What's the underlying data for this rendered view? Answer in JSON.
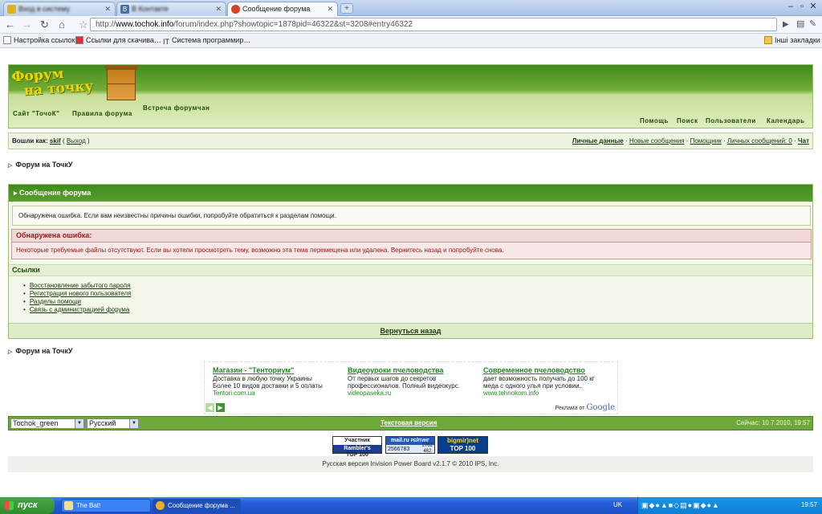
{
  "browser": {
    "tabs": [
      {
        "label": "Вход в систему",
        "active": false
      },
      {
        "label": "В Контакте",
        "active": false
      },
      {
        "label": "Сообщение форума",
        "active": true
      }
    ],
    "url_prefix": "http://",
    "url_host": "www.tochok.info",
    "url_path": "/forum/index.php?showtopic=1878pid=46322&st=3208#entry46322",
    "bookmarks": [
      "Настройка ссылок",
      "Ссылки для скачива…",
      "Система программир…"
    ],
    "other_bookmarks": "Інші закладки"
  },
  "forum": {
    "logo_line1": "Форум",
    "logo_line2": "на точку",
    "nav_left": [
      "Сайт \"ТочоК\"",
      "Правила форума"
    ],
    "nav_meeting": "Встреча форумчан",
    "nav_right": [
      "Помощь",
      "Поиск",
      "Пользователи",
      "Календарь"
    ]
  },
  "userbar": {
    "logged_in_as": "Вошли как:",
    "username": "skif",
    "logout": "Выход",
    "links": [
      "Личные данные",
      "Новые сообщения",
      "Помощник",
      "Личных сообщений: 0",
      "Чат"
    ]
  },
  "breadcrumb": "Форум на ТочкУ",
  "main": {
    "title": "Сообщение форума",
    "info": "Обнаружена ошибка. Если вам неизвестны причины ошибки, попробуйте обратиться к разделам помощи.",
    "error_title": "Обнаружена ошибка:",
    "error_text": "Некоторые требуемые файлы отсутствуют. Если вы хотели просмотреть тему, возможно эта тема перемещена или удалена. Вернитесь назад и попробуйте снова.",
    "links_title": "Ссылки",
    "links": [
      "Восстановление забытого пароля",
      "Регистрация нового пользователя",
      "Разделы помощи",
      "Связь с администрацией форума"
    ],
    "back": "Вернуться назад"
  },
  "ads": [
    {
      "title": "Магазин - \"Тенториум\"",
      "line1": "Доставка в любую точку Украины",
      "line2": "Более 10 видов доставки и 5 оплаты",
      "url": "Tentori.com.ua"
    },
    {
      "title": "Видеоуроки пчеловодства",
      "line1": "От первых шагов до секретов",
      "line2": "профессионалов. Полный видеокурс.",
      "url": "videopaseka.ru"
    },
    {
      "title": "Современное пчеловодство",
      "line1": "дает возможность получать до 100 кг",
      "line2": "меда с одного улья при условии..",
      "url": "www.tehnokom.info"
    }
  ],
  "ads_by": "Реклама от",
  "ads_brand": "Google",
  "footer": {
    "skin": "Tochok_green",
    "language": "Русский",
    "text_version": "Текстовая версия",
    "now": "Сейчас: 10.7.2010, 19:57",
    "copyright": "Русская версия Invision Power Board v2.1.7 © 2010  IPS, Inc."
  },
  "counters": {
    "rambler_1": "Участник",
    "rambler_2": "Rambler's",
    "rambler_3": "TOP 100",
    "mailru_brand": "mail.ru",
    "mailru_label": "РЕЙТИНГ",
    "mailru_count": "2566783",
    "mailru_a": "2762",
    "mailru_b": "462",
    "bigmir_1": "bigmir)net",
    "bigmir_2": "TOP 100"
  },
  "taskbar": {
    "start": "пуск",
    "tasks": [
      "The Bat!",
      "Сообщение форума ..."
    ],
    "lang": "UK",
    "clock": "19:57"
  }
}
